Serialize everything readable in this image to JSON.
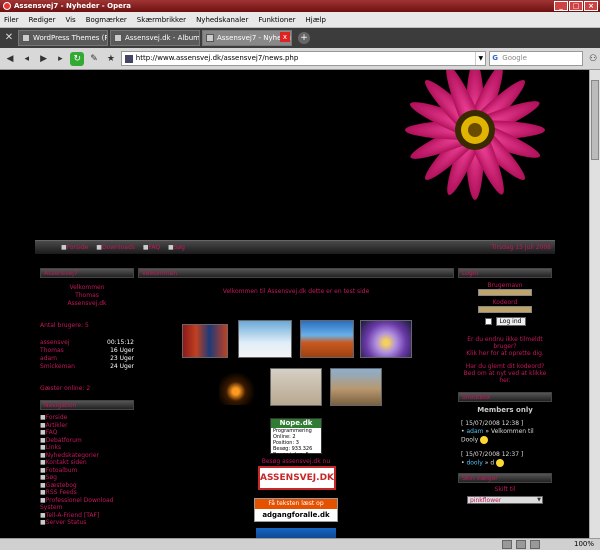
{
  "window": {
    "title": "Assensvej7 - Nyheder - Opera"
  },
  "menu": [
    "Filer",
    "Rediger",
    "Vis",
    "Bogmærker",
    "Skærmbrikker",
    "Nyhedskanaler",
    "Funktioner",
    "Hjælp"
  ],
  "tabs": [
    {
      "label": "WordPress Themes (P..."
    },
    {
      "label": "Assensvej.dk - Albums..."
    },
    {
      "label": "Assensvej7 - Nyheder"
    }
  ],
  "address": {
    "url": "http://www.assensvej.dk/assensvej7/news.php",
    "search_placeholder": "Google"
  },
  "status": {
    "zoom": "100%"
  },
  "left": {
    "head1": "Assensvej7",
    "welcome": [
      "Velkommen",
      "Thomas",
      "Assensvej.dk"
    ],
    "users_count": "Antal brugere: 5",
    "users": [
      {
        "name": "assensvej",
        "time": "00:15:12"
      },
      {
        "name": "Thomas",
        "time": "16 Uger"
      },
      {
        "name": "adam",
        "time": "23 Uger"
      },
      {
        "name": "Smickeman",
        "time": "24 Uger"
      }
    ],
    "online": "Gæster online: 2",
    "head2": "Navigation",
    "nav": [
      "Forside",
      "Artikler",
      "FAQ",
      "Debatforum",
      "Links",
      "Nyhedskategorier",
      "Kontakt siden",
      "Fotoalbum",
      "Søg",
      "Gæstebog",
      "RSS Feeds",
      "Professionel Download System",
      "Tell-A-Friend [TAF]",
      "Server Status"
    ]
  },
  "center": {
    "head": "Velkommen",
    "title": "Velkommen til Assensvej.dk dette er en test side",
    "nope": {
      "header": "Nope.dk",
      "lines": [
        "Programmering",
        "Online:   2",
        "Position:   3",
        "Besøg:   933.326",
        "Besøg i dag:   5"
      ]
    },
    "visit_link": "Besøg assensvej.dk nu",
    "assens_label": "ASSENSVEJ.DK",
    "adgang_top": "Få teksten læst op",
    "adgang_bottom": "adgangforalle.dk"
  },
  "right": {
    "head1": "Login",
    "username_label": "Brugernavn",
    "password_label": "Kodeord",
    "login_btn": "Log ind",
    "register_q": "Er du endnu ikke tilmeldt bruger?",
    "register_link": "Klik her for at oprette dig.",
    "forgot_q": "Har du glemt dit kodeord?",
    "forgot_link": "Bed om at nyt ved at klikke her.",
    "head2": "Shoutbox",
    "members_only": "Members only",
    "chat": [
      {
        "date": "[ 15/07/2008 12:38 ]",
        "name": "adam",
        "msg": "Velkommen til Dooly"
      },
      {
        "date": "[ 15/07/2008 12:37 ]",
        "name": "dooly",
        "msg": "d"
      }
    ],
    "head3": "Skin vælger",
    "skin_label": "Skift til",
    "skin_value": "pinkflower"
  }
}
